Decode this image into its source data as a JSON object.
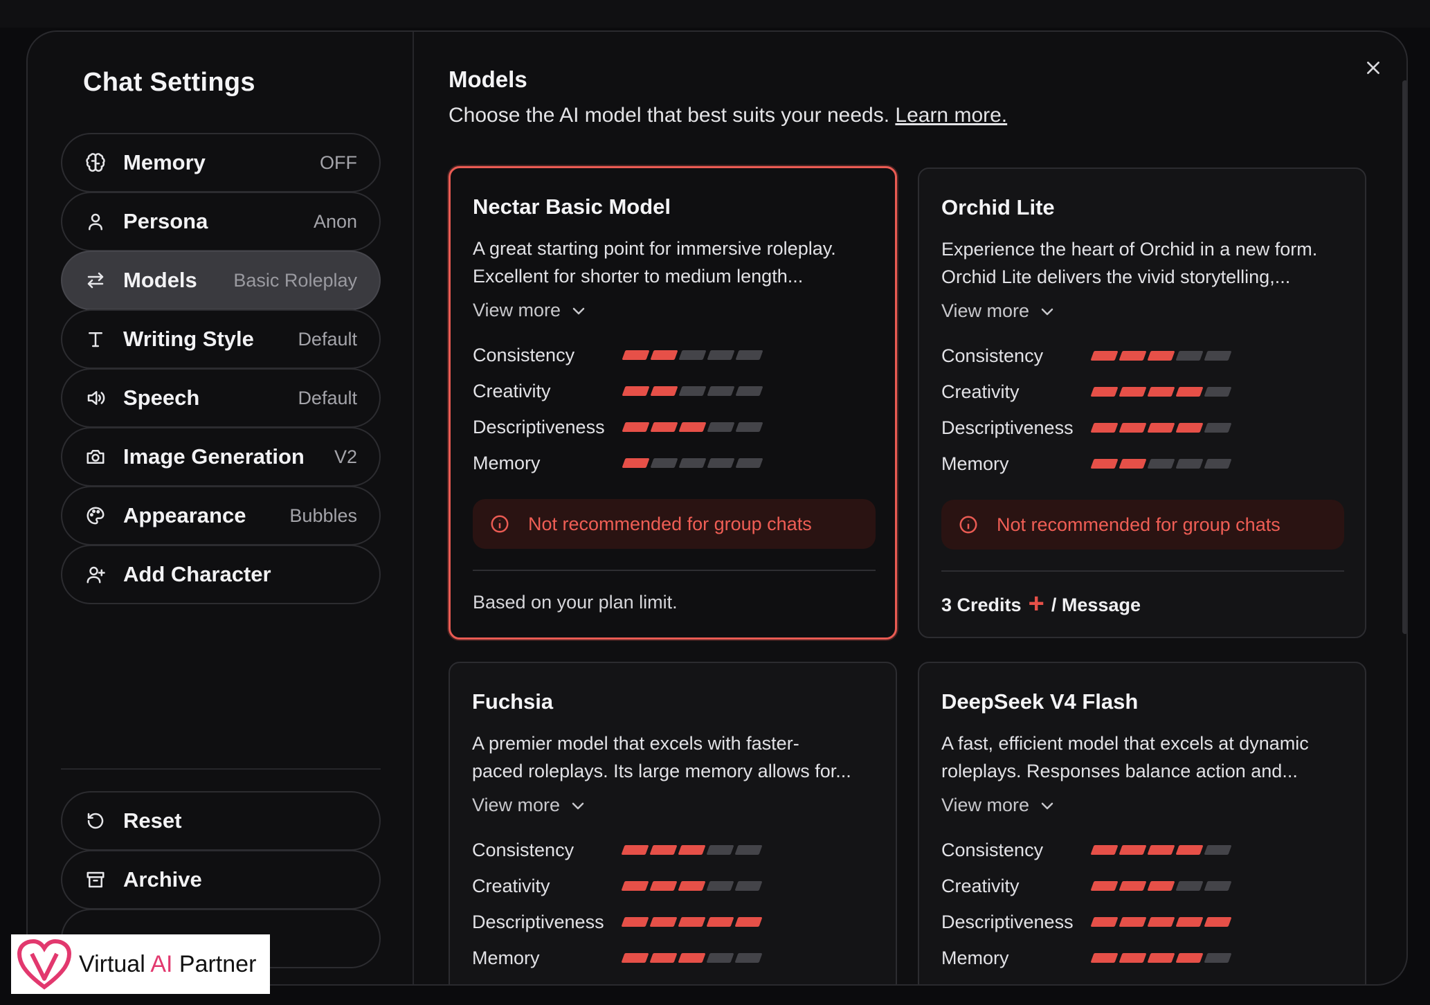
{
  "sidebar": {
    "title": "Chat Settings",
    "items": [
      {
        "label": "Memory",
        "value": "OFF",
        "icon": "brain-icon"
      },
      {
        "label": "Persona",
        "value": "Anon",
        "icon": "user-icon"
      },
      {
        "label": "Models",
        "value": "Basic Roleplay",
        "icon": "swap-arrows-icon"
      },
      {
        "label": "Writing Style",
        "value": "Default",
        "icon": "text-icon"
      },
      {
        "label": "Speech",
        "value": "Default",
        "icon": "speaker-icon"
      },
      {
        "label": "Image Generation",
        "value": "V2",
        "icon": "camera-icon"
      },
      {
        "label": "Appearance",
        "value": "Bubbles",
        "icon": "palette-icon"
      },
      {
        "label": "Add Character",
        "value": "",
        "icon": "user-plus-icon"
      }
    ],
    "actions": [
      {
        "label": "Reset",
        "icon": "reset-icon"
      },
      {
        "label": "Archive",
        "icon": "archive-icon"
      }
    ]
  },
  "main": {
    "title": "Models",
    "subtitle": "Choose the AI model that best suits your needs.",
    "learn_more": "Learn more.",
    "view_more": "View more",
    "stat_labels": [
      "Consistency",
      "Creativity",
      "Descriptiveness",
      "Memory"
    ],
    "models": [
      {
        "name": "Nectar Basic Model",
        "desc_line1": "A great starting point for immersive roleplay.",
        "desc_line2": "Excellent for shorter to medium length...",
        "stats": [
          2,
          2,
          3,
          1
        ],
        "warning": "Not recommended for group chats",
        "footer": "Based on your plan limit.",
        "selected": true
      },
      {
        "name": "Orchid Lite",
        "desc_line1": "Experience the heart of Orchid in a new form.",
        "desc_line2": "Orchid Lite delivers the vivid storytelling,...",
        "stats": [
          3,
          4,
          4,
          2
        ],
        "warning": "Not recommended for group chats",
        "credits": "3 Credits",
        "per_message": "/ Message",
        "selected": false
      },
      {
        "name": "Fuchsia",
        "desc_line1": "A premier model that excels with faster-",
        "desc_line2": "paced roleplays. Its large memory allows for...",
        "stats": [
          3,
          3,
          5,
          3
        ],
        "selected": false
      },
      {
        "name": "DeepSeek V4 Flash",
        "desc_line1": "A fast, efficient model that excels at dynamic",
        "desc_line2": "roleplays. Responses balance action and...",
        "stats": [
          4,
          3,
          5,
          4
        ],
        "selected": false
      }
    ]
  },
  "watermark": {
    "prefix": "Virtual ",
    "ai": "AI",
    "suffix": " Partner"
  },
  "colors": {
    "accent": "#e65048",
    "bar_off": "#444449",
    "panel": "#0f0f11"
  }
}
